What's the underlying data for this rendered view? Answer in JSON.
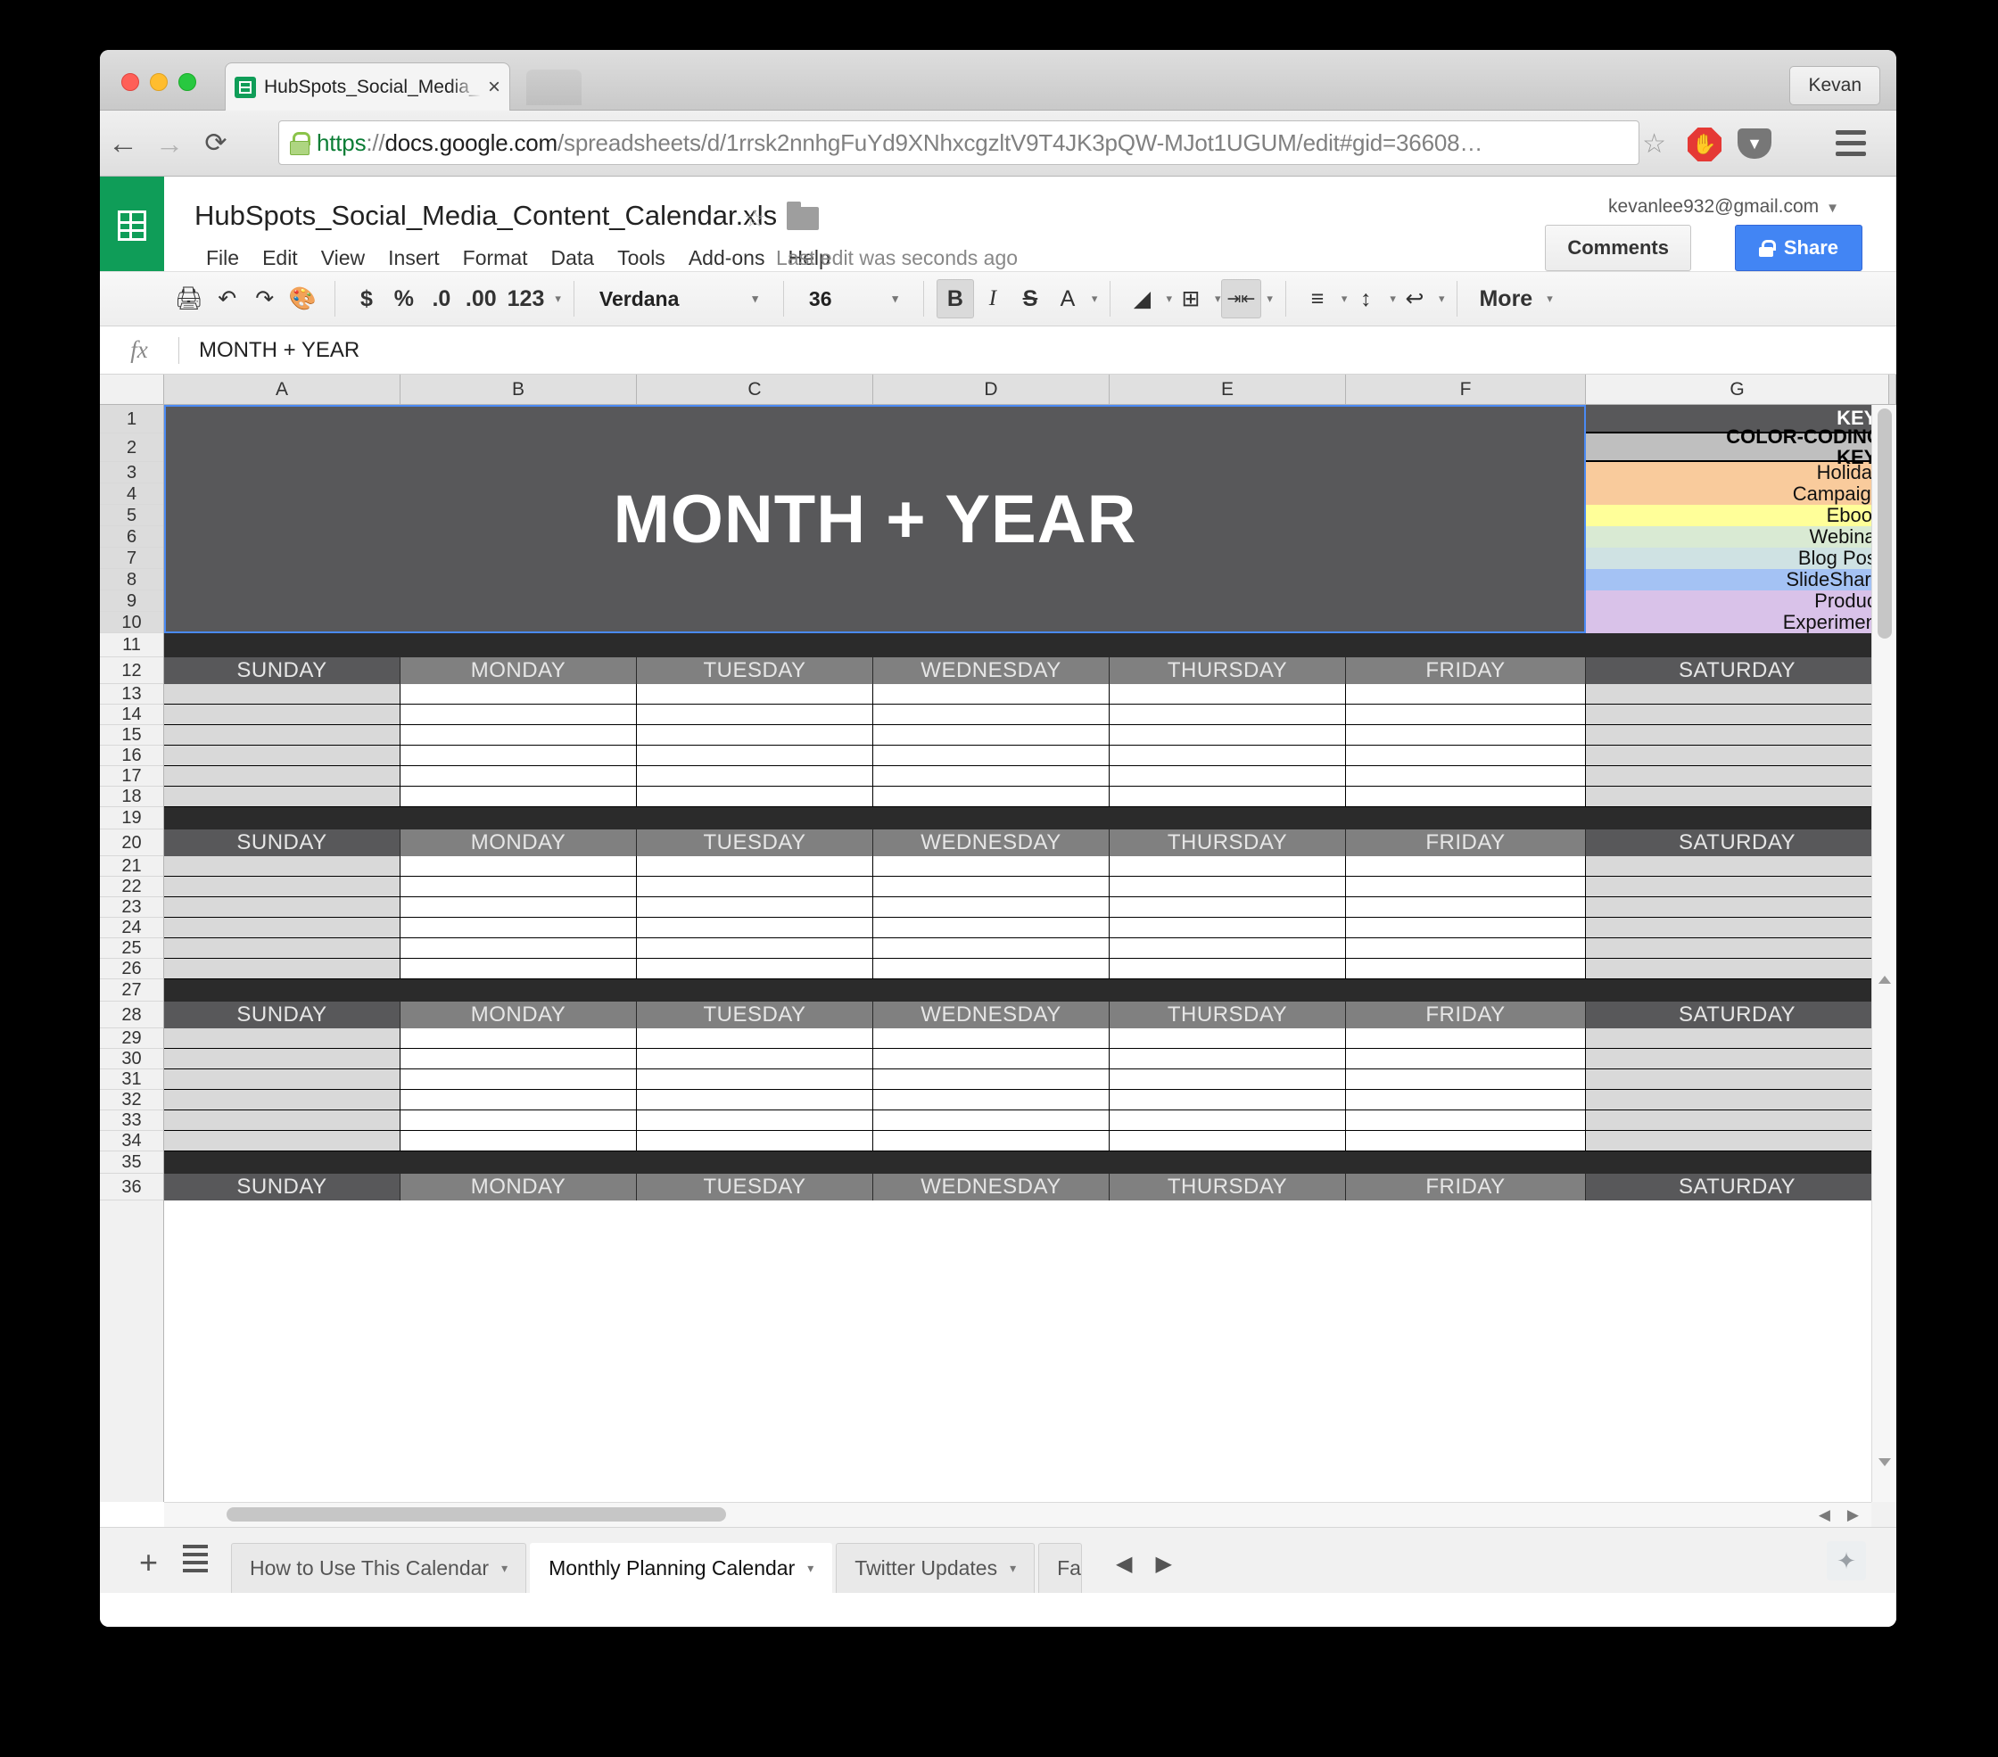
{
  "browser": {
    "tab_title": "HubSpots_Social_Media_C",
    "tab_close": "×",
    "user_label": "Kevan",
    "back_icon": "←",
    "forward_icon": "→",
    "reload_icon": "⟳",
    "url": {
      "scheme": "https",
      "separator": "://",
      "host": "docs.google.com",
      "path": "/spreadsheets/d/1rrsk2nnhgFuYd9XNhxcgzltV9T4JK3pQW-MJot1UGUM/edit#gid=36608…"
    },
    "star_icon": "☆",
    "adblock_icon": "✋",
    "pocket_icon": "▼"
  },
  "doc": {
    "title": "HubSpots_Social_Media_Content_Calendar.xls",
    "menus": [
      "File",
      "Edit",
      "View",
      "Insert",
      "Format",
      "Data",
      "Tools",
      "Add-ons",
      "Help"
    ],
    "last_edit": "Last edit was seconds ago",
    "account": "kevanlee932@gmail.com",
    "account_caret": "▼",
    "comments_label": "Comments",
    "share_label": "Share"
  },
  "toolbar": {
    "print": "⎙",
    "undo": "↶",
    "redo": "↷",
    "paint": "⎙",
    "currency": "$",
    "percent": "%",
    "dec_decimal": ".0",
    "inc_decimal": ".00",
    "number_format": "123",
    "font_name": "Verdana",
    "font_size": "36",
    "bold": "B",
    "italic": "I",
    "strikethrough": "S",
    "text_color": "A",
    "fill_color": "◢",
    "borders": "⊞",
    "merge": "⇥⇤",
    "halign": "≡",
    "valign": "↕",
    "wrap": "↩",
    "more_label": "More",
    "caret": "▾"
  },
  "formula_bar": {
    "fx": "fx",
    "value": "MONTH + YEAR"
  },
  "grid": {
    "columns": [
      "A",
      "B",
      "C",
      "D",
      "E",
      "F",
      "G"
    ],
    "rows": [
      1,
      2,
      3,
      4,
      5,
      6,
      7,
      8,
      9,
      10,
      11,
      12,
      13,
      14,
      15,
      16,
      17,
      18,
      19,
      20,
      21,
      22,
      23,
      24,
      25,
      26,
      27,
      28,
      29,
      30,
      31,
      32,
      33,
      34,
      35,
      36
    ],
    "banner_text": "MONTH + YEAR",
    "key": {
      "header": "KEY:",
      "subheader_line1": "COLOR-CODING",
      "subheader_line2": "KEY:",
      "items": [
        {
          "label": "Holiday",
          "color": "#f9cb9c"
        },
        {
          "label": "Campaign",
          "color": "#f9cb9c"
        },
        {
          "label": "Ebook",
          "color": "#ffff99"
        },
        {
          "label": "Webinar",
          "color": "#d9ead3"
        },
        {
          "label": "Blog Post",
          "color": "#cfe2e3"
        },
        {
          "label": "SlideShare",
          "color": "#a4c2f4"
        },
        {
          "label": "Product",
          "color": "#d9c2e9"
        },
        {
          "label": "Experiment",
          "color": "#d9c2e9"
        }
      ]
    },
    "weekdays": [
      "SUNDAY",
      "MONDAY",
      "TUESDAY",
      "WEDNESDAY",
      "THURSDAY",
      "FRIDAY",
      "SATURDAY"
    ],
    "week_blocks": 4
  },
  "sheet_tabs": {
    "add_icon": "+",
    "tabs": [
      {
        "label": "How to Use This Calendar",
        "active": false
      },
      {
        "label": "Monthly Planning Calendar",
        "active": true
      },
      {
        "label": "Twitter Updates",
        "active": false
      },
      {
        "label": "Fa",
        "active": false
      }
    ],
    "caret": "▾",
    "prev_icon": "◀",
    "next_icon": "▶",
    "explore_icon": "✦"
  }
}
